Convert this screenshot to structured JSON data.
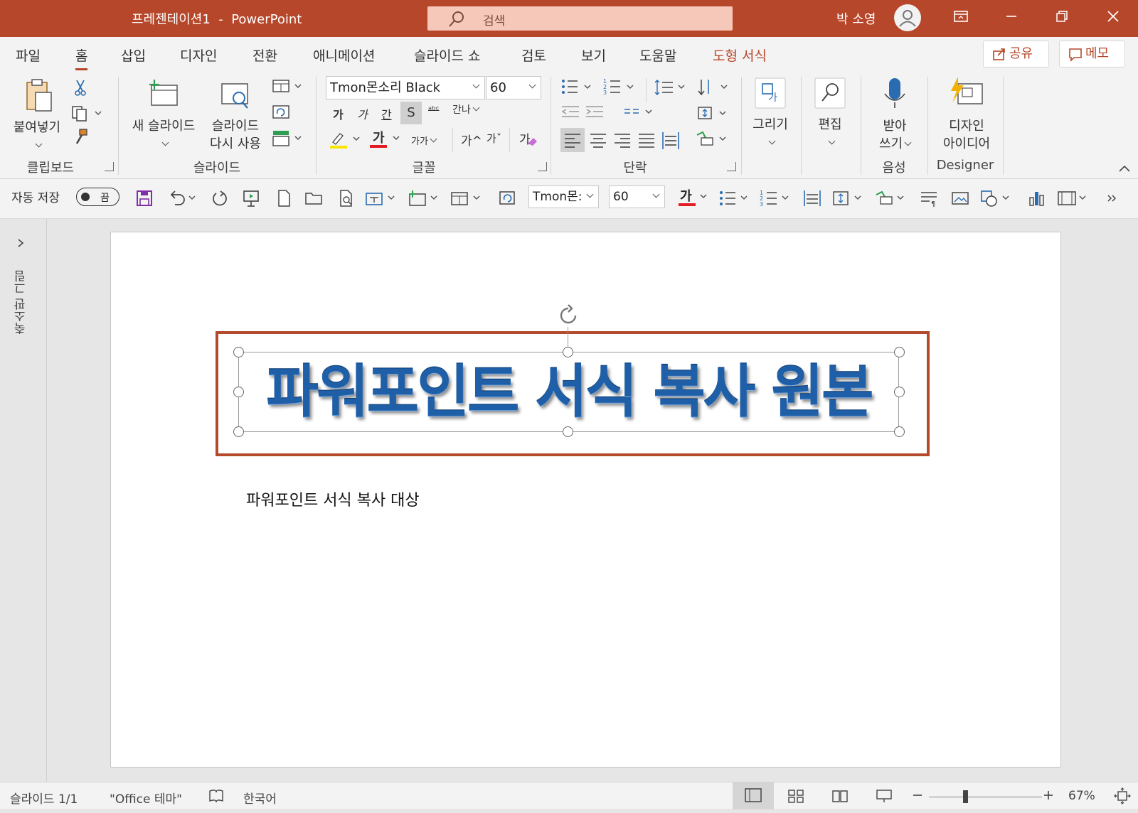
{
  "window": {
    "title": "프레젠테이션1  -  PowerPoint",
    "search_placeholder": "검색",
    "user": "박 소영"
  },
  "tabs": [
    "파일",
    "홈",
    "삽입",
    "디자인",
    "전환",
    "애니메이션",
    "슬라이드 쇼",
    "검토",
    "보기",
    "도움말",
    "도형 서식"
  ],
  "selected_tab": "홈",
  "actions": {
    "share": "공유",
    "comments": "메모"
  },
  "ribbon": {
    "clipboard": {
      "label": "클립보드",
      "paste": "붙여넣기"
    },
    "slides": {
      "label": "슬라이드",
      "new_slide": "새 슬라이드",
      "reuse_line1": "슬라이드",
      "reuse_line2": "다시 사용"
    },
    "font": {
      "label": "글꼴",
      "font_name": "Tmon몬소리 Black",
      "font_size": "60",
      "bold": "가",
      "italic": "가",
      "underline": "간",
      "shadow": "S",
      "strike": "ᵃᵇᶜ",
      "spacing": "간나",
      "color_glyph": "가",
      "change_case": "가가",
      "grow": "가^",
      "shrink": "가ˇ",
      "clear": "가"
    },
    "paragraph": {
      "label": "단락"
    },
    "drawing": {
      "label": "그리기"
    },
    "editing": {
      "label": "편집"
    },
    "voice": {
      "label": "음성",
      "dictate_line1": "받아",
      "dictate_line2": "쓰기"
    },
    "designer": {
      "label": "Designer",
      "ideas_line1": "디자인",
      "ideas_line2": "아이디어"
    }
  },
  "qat": {
    "autosave_label": "자동 저장",
    "autosave_state": "끔",
    "font_name": "Tmon몬:",
    "font_size": "60",
    "color_glyph": "가"
  },
  "left_panel": {
    "label": "축소판 그림"
  },
  "slide": {
    "title": "파워포인트 서식 복사 원본",
    "body": "파워포인트 서식 복사 대상"
  },
  "status": {
    "slide_info": "슬라이드 1/1",
    "theme": "\"Office 테마\"",
    "language": "한국어",
    "zoom": "67%"
  },
  "colors": {
    "accent": "#b7472a",
    "title_text": "#1f5fa8",
    "frame": "#b34a2b"
  }
}
